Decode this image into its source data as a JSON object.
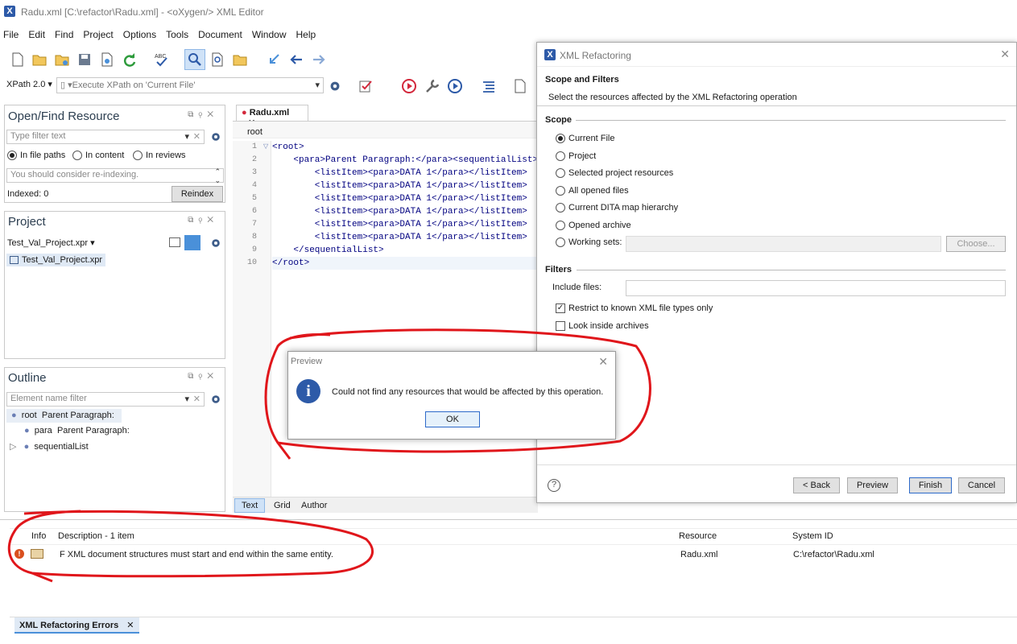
{
  "window": {
    "title": "Radu.xml [C:\\refactor\\Radu.xml] - <oXygen/> XML Editor",
    "logo": "X"
  },
  "menu": [
    "File",
    "Edit",
    "Find",
    "Project",
    "Options",
    "Tools",
    "Document",
    "Window",
    "Help"
  ],
  "xpath": {
    "version": "XPath 2.0",
    "execute": "Execute XPath on  'Current File'"
  },
  "openfind": {
    "title": "Open/Find Resource",
    "filter_placeholder": "Type filter text",
    "opt1": "In file paths",
    "opt2": "In content",
    "opt3": "In reviews",
    "notice": "You should consider re-indexing.",
    "indexed": "Indexed: 0",
    "reindex": "Reindex"
  },
  "project": {
    "title": "Project",
    "combo": "Test_Val_Project.xpr",
    "item": "Test_Val_Project.xpr"
  },
  "outline": {
    "title": "Outline",
    "filter_placeholder": "Element name filter",
    "n1_tag": "root",
    "n1_text": "Parent Paragraph:",
    "n2_tag": "para",
    "n2_text": "Parent Paragraph:",
    "n3_tag": "sequentialList"
  },
  "editor": {
    "tab": "Radu.xml",
    "breadcrumb": "root",
    "lines": [
      "<root>",
      "    <para>Parent Paragraph:</para><sequentialList>",
      "        <listItem><para>DATA 1</para></listItem>",
      "        <listItem><para>DATA 1</para></listItem>",
      "        <listItem><para>DATA 1</para></listItem>",
      "        <listItem><para>DATA 1</para></listItem>",
      "        <listItem><para>DATA 1</para></listItem>",
      "        <listItem><para>DATA 1</para></listItem>",
      "    </sequentialList>",
      "</root>"
    ],
    "line_numbers": [
      "1",
      "2",
      "3",
      "4",
      "5",
      "6",
      "7",
      "8",
      "9",
      "10"
    ],
    "modes": [
      "Text",
      "Grid",
      "Author"
    ]
  },
  "refactor": {
    "title": "XML Refactoring",
    "heading": "Scope and Filters",
    "subheading": "Select the resources affected by the XML Refactoring operation",
    "scope_label": "Scope",
    "scope": [
      "Current File",
      "Project",
      "Selected project resources",
      "All opened files",
      "Current DITA map hierarchy",
      "Opened archive",
      "Working sets:"
    ],
    "choose": "Choose...",
    "filters_label": "Filters",
    "include_files": "Include files:",
    "restrict": "Restrict to known XML file types only",
    "look_inside": "Look inside archives",
    "back": "< Back",
    "preview": "Preview",
    "finish": "Finish",
    "cancel": "Cancel"
  },
  "preview_dialog": {
    "title": "Preview",
    "message": "Could not find any resources that would be affected by this operation.",
    "ok": "OK"
  },
  "errors": {
    "col_info": "Info",
    "col_desc": "Description - 1 item",
    "col_resource": "Resource",
    "col_system": "System ID",
    "row_desc": "F XML document structures must start and end within the same entity.",
    "row_resource": "Radu.xml",
    "row_system": "C:\\refactor\\Radu.xml",
    "tab": "XML Refactoring Errors"
  },
  "colors": {
    "accent": "#2d5aa8",
    "annotation": "#e0161b",
    "tag": "#000080"
  }
}
